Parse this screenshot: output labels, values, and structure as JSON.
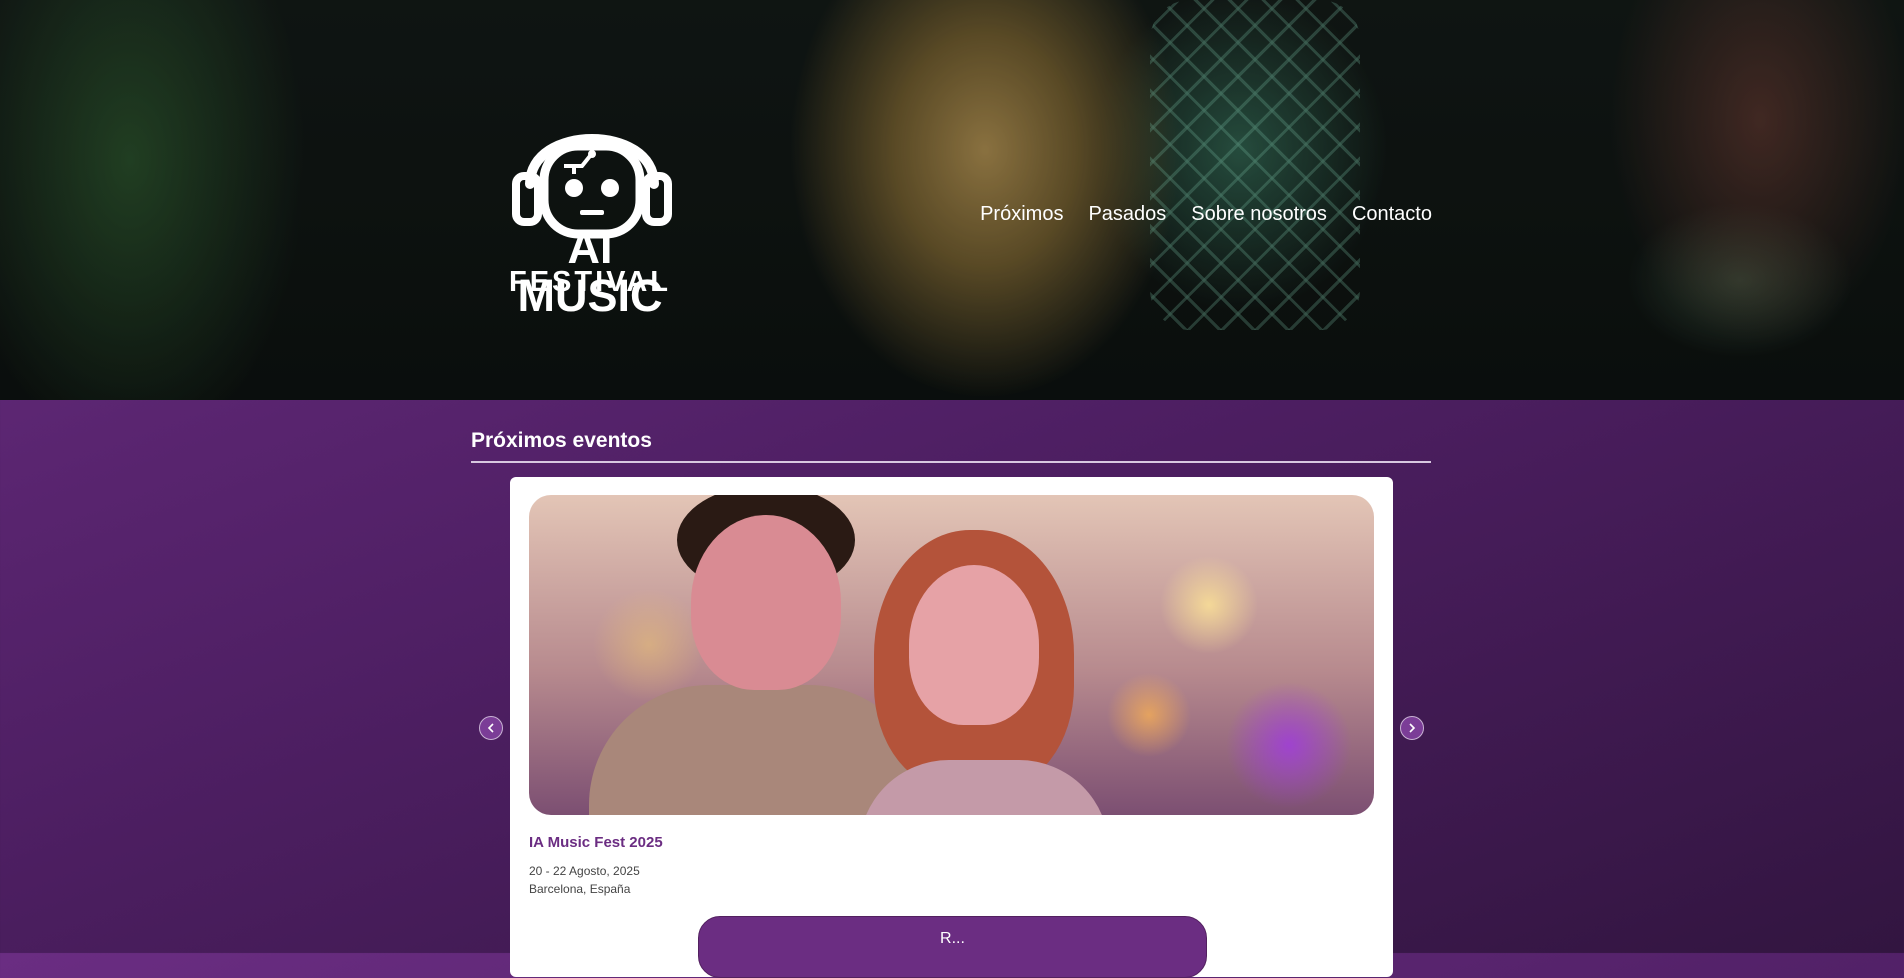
{
  "header": {
    "logo": {
      "line1": "AI MUSIC",
      "line2": "FESTIVAL"
    },
    "nav": [
      {
        "label": "Próximos"
      },
      {
        "label": "Pasados"
      },
      {
        "label": "Sobre nosotros"
      },
      {
        "label": "Contacto"
      }
    ]
  },
  "section": {
    "title": "Próximos eventos"
  },
  "carousel": {
    "prev_icon": "chevron-left-icon",
    "next_icon": "chevron-right-icon",
    "event": {
      "title": "IA Music Fest 2025",
      "date": "20 - 22 Agosto, 2025",
      "location": "Barcelona, España",
      "button_label": "R..."
    }
  },
  "colors": {
    "brand_purple": "#6b2d82",
    "background_purple": "#5a2570"
  }
}
